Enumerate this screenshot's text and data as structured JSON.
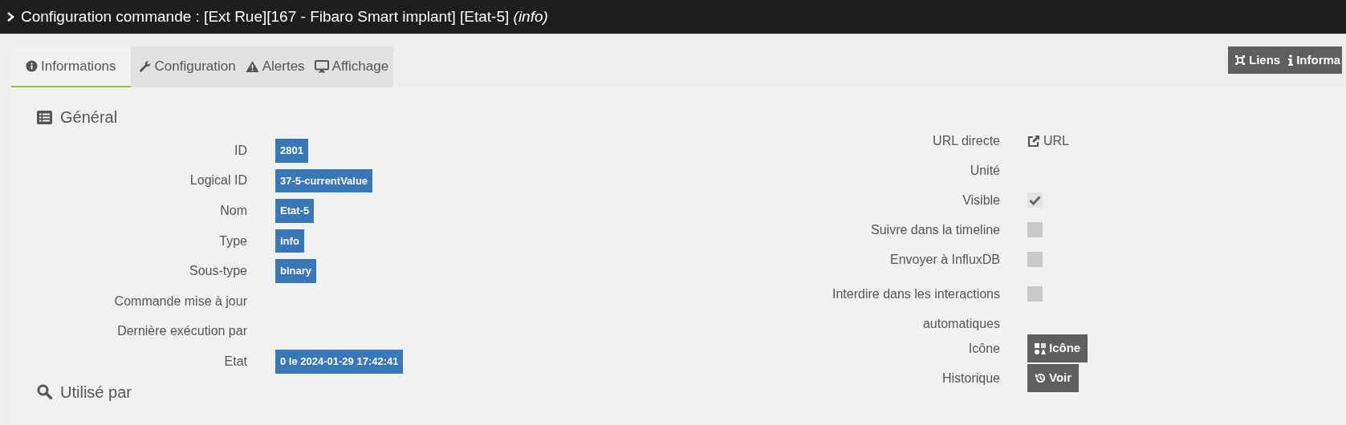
{
  "window": {
    "title": "Configuration commande : [Ext Rue][167 - Fibaro Smart implant] [Etat-5] *(info)*"
  },
  "tabs": [
    {
      "label": "Informations",
      "selected": true
    },
    {
      "label": "Configuration",
      "selected": false
    },
    {
      "label": "Alertes",
      "selected": false
    },
    {
      "label": "Affichage",
      "selected": false
    }
  ],
  "top_buttons": [
    {
      "label": "Liens"
    },
    {
      "label": "Informa"
    }
  ],
  "general": {
    "title": "Général",
    "fields": [
      {
        "label": "ID",
        "value": "2801"
      },
      {
        "label": "Logical ID",
        "value": "37-5-currentValue"
      },
      {
        "label": "Nom",
        "value": "Etat-5"
      },
      {
        "label": "Type",
        "value": "info"
      },
      {
        "label": "Sous-type",
        "value": "binary"
      },
      {
        "label": "Commande mise à jour"
      },
      {
        "label": "Dernière exécution par"
      },
      {
        "label": "Etat",
        "value": "0 le 2024-01-29 17:42:41"
      }
    ]
  },
  "options": [
    {
      "kind": "link",
      "label": "URL directe",
      "value": "URL"
    },
    {
      "kind": "text",
      "label": "Unité"
    },
    {
      "kind": "checkbox",
      "label": "Visible",
      "checked": true
    },
    {
      "kind": "checkbox",
      "label": "Suivre dans la timeline",
      "checked": false
    },
    {
      "kind": "checkbox",
      "label": "Envoyer à InfluxDB",
      "checked": false
    },
    {
      "kind": "checkbox",
      "label": "Interdire dans les interactions automatiques",
      "checked": false
    },
    {
      "kind": "button",
      "label": "Icône",
      "value": "Icône"
    },
    {
      "kind": "button",
      "label": "Historique",
      "value": "Voir"
    }
  ],
  "used_by": {
    "title": "Utilisé par"
  }
}
